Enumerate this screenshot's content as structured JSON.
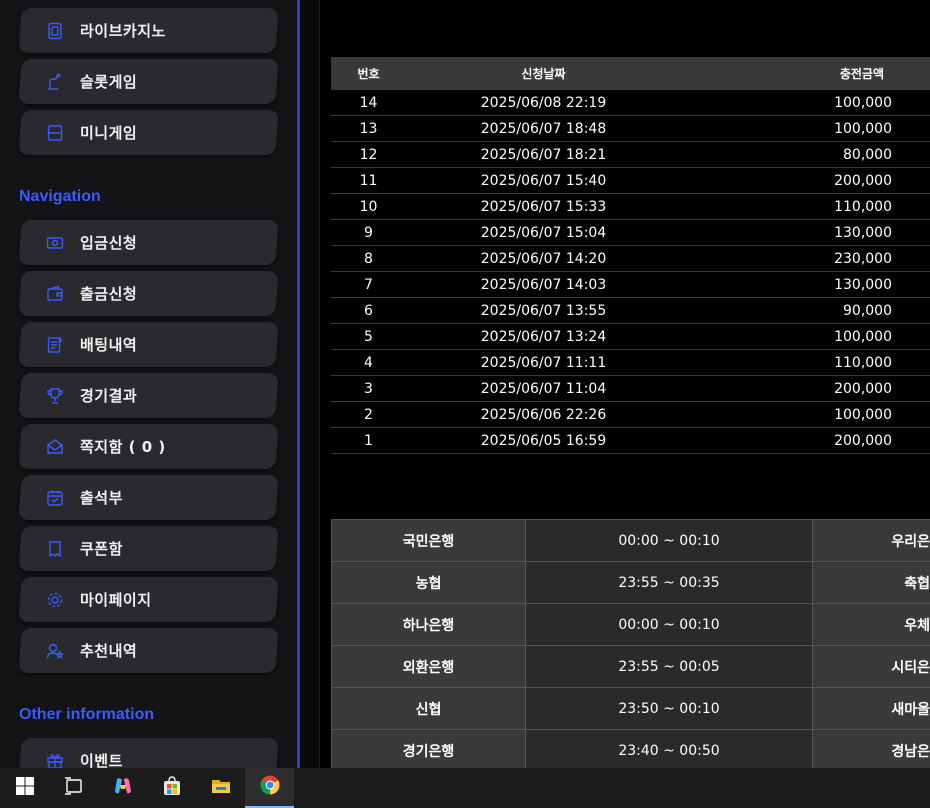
{
  "sidebar": {
    "top_items": [
      {
        "label": "라이브카지노",
        "icon": "casino-icon"
      },
      {
        "label": "슬롯게임",
        "icon": "slot-icon"
      },
      {
        "label": "미니게임",
        "icon": "minigame-icon"
      }
    ],
    "navigation_title": "Navigation",
    "navigation_items": [
      {
        "label": "입금신청",
        "icon": "deposit-icon"
      },
      {
        "label": "출금신청",
        "icon": "wallet-icon"
      },
      {
        "label": "배팅내역",
        "icon": "betting-history-icon"
      },
      {
        "label": "경기결과",
        "icon": "trophy-icon"
      },
      {
        "label": "쪽지함 ( 0 )",
        "icon": "mail-icon"
      },
      {
        "label": "출석부",
        "icon": "calendar-check-icon"
      },
      {
        "label": "쿠폰함",
        "icon": "coupon-icon"
      },
      {
        "label": "마이페이지",
        "icon": "gear-icon"
      },
      {
        "label": "추천내역",
        "icon": "user-star-icon"
      }
    ],
    "other_title": "Other information",
    "other_items": [
      {
        "label": "이벤트",
        "icon": "gift-icon"
      }
    ],
    "accent_color": "#3b5bff"
  },
  "history": {
    "headers": {
      "no": "번호",
      "date": "신청날짜",
      "amount": "충전금액"
    },
    "rows": [
      {
        "no": "14",
        "date": "2025/06/08 22:19",
        "amount": "100,000"
      },
      {
        "no": "13",
        "date": "2025/06/07 18:48",
        "amount": "100,000"
      },
      {
        "no": "12",
        "date": "2025/06/07 18:21",
        "amount": "80,000"
      },
      {
        "no": "11",
        "date": "2025/06/07 15:40",
        "amount": "200,000"
      },
      {
        "no": "10",
        "date": "2025/06/07 15:33",
        "amount": "110,000"
      },
      {
        "no": "9",
        "date": "2025/06/07 15:04",
        "amount": "130,000"
      },
      {
        "no": "8",
        "date": "2025/06/07 14:20",
        "amount": "230,000"
      },
      {
        "no": "7",
        "date": "2025/06/07 14:03",
        "amount": "130,000"
      },
      {
        "no": "6",
        "date": "2025/06/07 13:55",
        "amount": "90,000"
      },
      {
        "no": "5",
        "date": "2025/06/07 13:24",
        "amount": "100,000"
      },
      {
        "no": "4",
        "date": "2025/06/07 11:11",
        "amount": "110,000"
      },
      {
        "no": "3",
        "date": "2025/06/07 11:04",
        "amount": "200,000"
      },
      {
        "no": "2",
        "date": "2025/06/06 22:26",
        "amount": "100,000"
      },
      {
        "no": "1",
        "date": "2025/06/05 16:59",
        "amount": "200,000"
      }
    ]
  },
  "banks": [
    {
      "name": "국민은행",
      "time": "00:00 ~ 00:10",
      "name2": "우리은"
    },
    {
      "name": "농협",
      "time": "23:55 ~ 00:35",
      "name2": "축협"
    },
    {
      "name": "하나은행",
      "time": "00:00 ~ 00:10",
      "name2": "우체"
    },
    {
      "name": "외환은행",
      "time": "23:55 ~ 00:05",
      "name2": "시티은"
    },
    {
      "name": "신협",
      "time": "23:50 ~ 00:10",
      "name2": "새마을"
    },
    {
      "name": "경기은행",
      "time": "23:40 ~ 00:50",
      "name2": "경남은"
    }
  ],
  "taskbar": {
    "items": [
      {
        "icon": "windows-start-icon"
      },
      {
        "icon": "task-view-icon"
      },
      {
        "icon": "copilot-icon"
      },
      {
        "icon": "store-icon"
      },
      {
        "icon": "file-explorer-icon"
      },
      {
        "icon": "chrome-icon",
        "active": true
      }
    ]
  }
}
